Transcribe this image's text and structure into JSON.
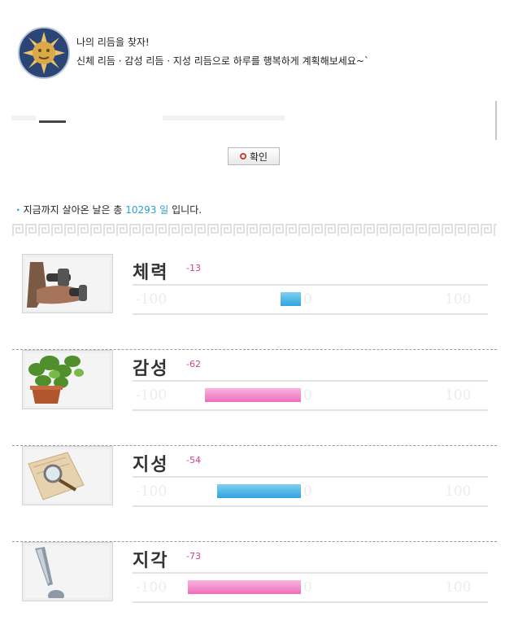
{
  "header": {
    "title": "나의 리듬을 찾자!",
    "subtitle": "신체 리듬 · 감성 리듬 · 지성 리듬으로 하루를 행복하게 계획해보세요~`",
    "logo": "sun-face-icon"
  },
  "confirm_label": "확인",
  "days": {
    "prefix": "지금까지 살아온 날은 총",
    "number": "10293",
    "unit": "일",
    "suffix": "입니다."
  },
  "scale": {
    "min": "-100",
    "zero": "0",
    "max": "100"
  },
  "rhythms": [
    {
      "label": "체력",
      "value": "-13",
      "numeric": -13,
      "color": "blue",
      "icon": "dumbbell-arm-icon"
    },
    {
      "label": "감성",
      "value": "-62",
      "numeric": -62,
      "color": "pink",
      "icon": "potted-plant-icon"
    },
    {
      "label": "지성",
      "value": "-54",
      "numeric": -54,
      "color": "blue",
      "icon": "magnifier-book-icon"
    },
    {
      "label": "지각",
      "value": "-73",
      "numeric": -73,
      "color": "pink",
      "icon": "exclamation-icon"
    }
  ],
  "colors": {
    "blue": "#2fa3de",
    "pink": "#ec6fbd",
    "value_text": "#d0408c",
    "accent": "#2a9fd6"
  }
}
